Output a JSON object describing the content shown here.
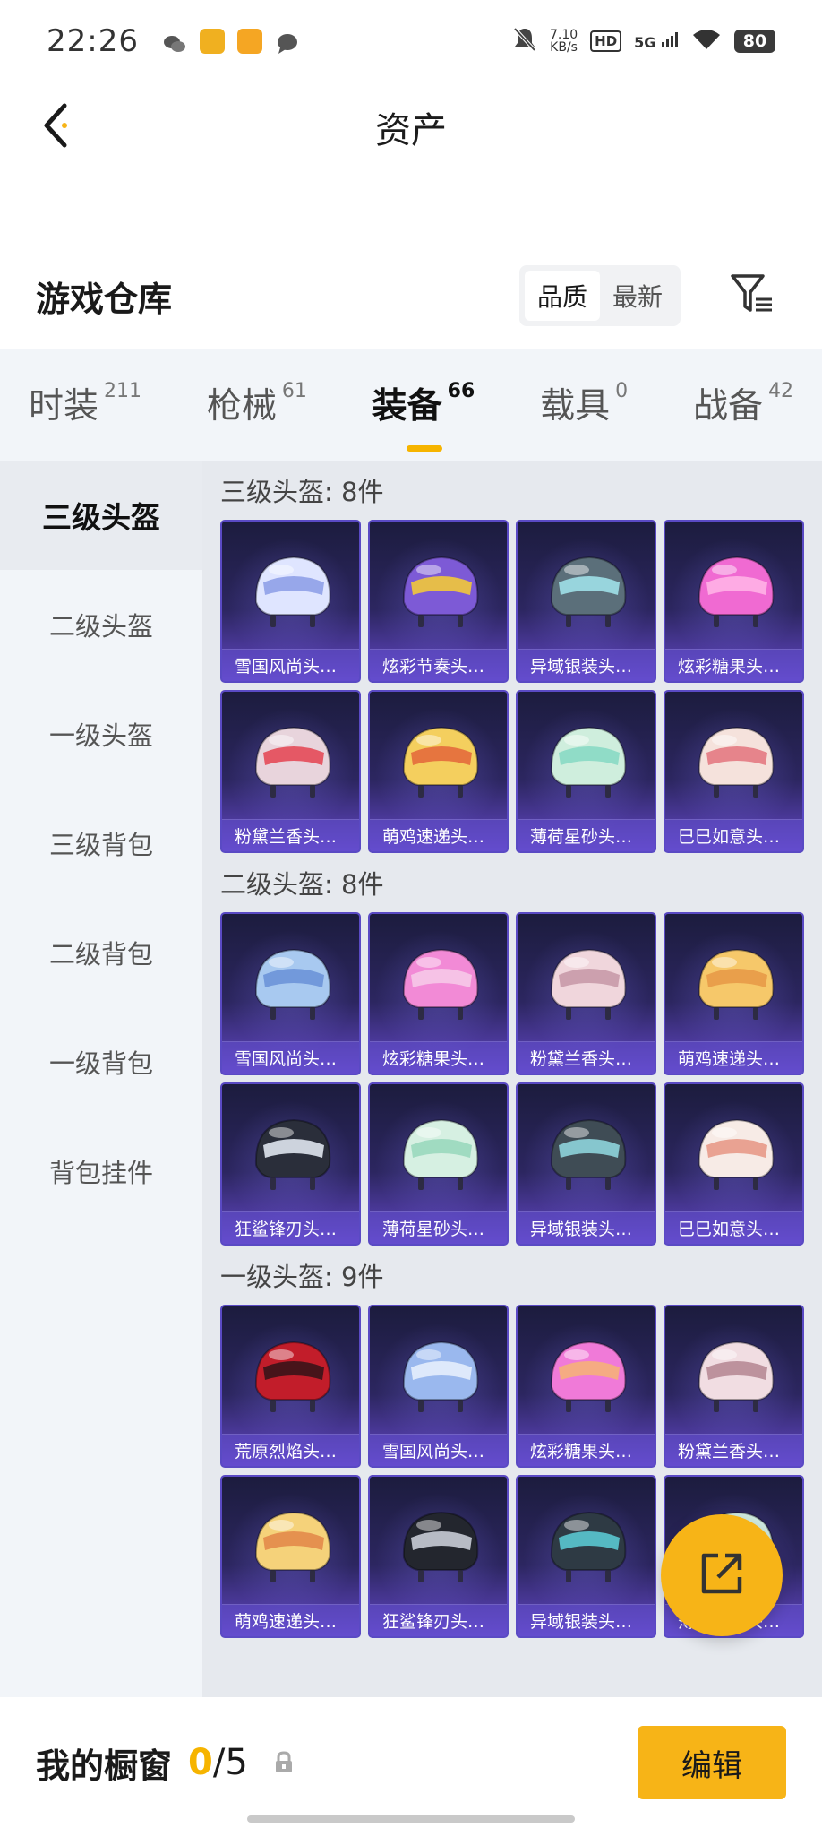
{
  "status_bar": {
    "time": "22:26",
    "net_speed_value": "7.10",
    "net_speed_unit": "KB/s",
    "hd": "HD",
    "signal": "5G",
    "battery": "80"
  },
  "header": {
    "title": "资产",
    "back_icon": "back-chevron-icon"
  },
  "warehouse": {
    "title": "游戏仓库",
    "sort_options": [
      "品质",
      "最新"
    ],
    "active_sort": "品质",
    "filter_icon": "filter-icon"
  },
  "tabs": [
    {
      "label": "时装",
      "count": "211",
      "active": false
    },
    {
      "label": "枪械",
      "count": "61",
      "active": false
    },
    {
      "label": "装备",
      "count": "66",
      "active": true
    },
    {
      "label": "载具",
      "count": "0",
      "active": false
    },
    {
      "label": "战备",
      "count": "42",
      "active": false
    }
  ],
  "side_nav": [
    {
      "label": "三级头盔",
      "active": true
    },
    {
      "label": "二级头盔",
      "active": false
    },
    {
      "label": "一级头盔",
      "active": false
    },
    {
      "label": "三级背包",
      "active": false
    },
    {
      "label": "二级背包",
      "active": false
    },
    {
      "label": "一级背包",
      "active": false
    },
    {
      "label": "背包挂件",
      "active": false
    }
  ],
  "sections": [
    {
      "title": "三级头盔: 8件",
      "items": [
        {
          "name": "雪国风尚头…",
          "colors": [
            "#dfe5ff",
            "#8fa0e8"
          ]
        },
        {
          "name": "炫彩节奏头…",
          "colors": [
            "#7d5ad6",
            "#f2c83a"
          ]
        },
        {
          "name": "异域银装头…",
          "colors": [
            "#5b6f7a",
            "#9fe0e8"
          ]
        },
        {
          "name": "炫彩糖果头…",
          "colors": [
            "#f06ad2",
            "#ffb3e6"
          ]
        },
        {
          "name": "粉黛兰香头…",
          "colors": [
            "#e8d4dc",
            "#e44a58"
          ]
        },
        {
          "name": "萌鸡速递头…",
          "colors": [
            "#f4cf5e",
            "#e46a3c"
          ]
        },
        {
          "name": "薄荷星砂头…",
          "colors": [
            "#cfeedd",
            "#88d9c4"
          ]
        },
        {
          "name": "巳巳如意头…",
          "colors": [
            "#f5e2dc",
            "#e47a82"
          ]
        }
      ]
    },
    {
      "title": "二级头盔: 8件",
      "items": [
        {
          "name": "雪国风尚头…",
          "colors": [
            "#a8c9f0",
            "#6c93d8"
          ]
        },
        {
          "name": "炫彩糖果头…",
          "colors": [
            "#f28ad6",
            "#f6c8e8"
          ]
        },
        {
          "name": "粉黛兰香头…",
          "colors": [
            "#f0d6dc",
            "#c89aa8"
          ]
        },
        {
          "name": "萌鸡速递头…",
          "colors": [
            "#f6c86a",
            "#e89a48"
          ]
        },
        {
          "name": "狂鲨锋刃头…",
          "colors": [
            "#2a2e3a",
            "#dfe6f0"
          ]
        },
        {
          "name": "薄荷星砂头…",
          "colors": [
            "#d6f0e2",
            "#9ad8be"
          ]
        },
        {
          "name": "异域银装头…",
          "colors": [
            "#3f4c55",
            "#8ed4dc"
          ]
        },
        {
          "name": "巳巳如意头…",
          "colors": [
            "#f7ebe6",
            "#e79a88"
          ]
        }
      ]
    },
    {
      "title": "一级头盔: 9件",
      "items": [
        {
          "name": "荒原烈焰头…",
          "colors": [
            "#c21d2a",
            "#3a1418"
          ]
        },
        {
          "name": "雪国风尚头…",
          "colors": [
            "#9ab8ee",
            "#e6eefc"
          ]
        },
        {
          "name": "炫彩糖果头…",
          "colors": [
            "#f07ad8",
            "#f5b07a"
          ]
        },
        {
          "name": "粉黛兰香头…",
          "colors": [
            "#f1dde2",
            "#b78a96"
          ]
        },
        {
          "name": "萌鸡速递头…",
          "colors": [
            "#f5d27a",
            "#e38a4a"
          ]
        },
        {
          "name": "狂鲨锋刃头…",
          "colors": [
            "#23262e",
            "#c8ccd6"
          ]
        },
        {
          "name": "异域银装头…",
          "colors": [
            "#2e3a44",
            "#5ac8d2"
          ]
        },
        {
          "name": "薄荷星砂头…",
          "colors": [
            "#cfeadf",
            "#9ad8c2"
          ]
        }
      ]
    }
  ],
  "fab": {
    "icon": "share-external-icon"
  },
  "bottom_bar": {
    "label": "我的橱窗",
    "count_current": "0",
    "count_sep": "/",
    "count_max": "5",
    "lock_icon": "lock-icon",
    "edit_label": "编辑"
  },
  "colors": {
    "accent": "#f7b417",
    "card_bg_top": "#1c1c3e",
    "card_bg_bottom": "#6448c9"
  }
}
